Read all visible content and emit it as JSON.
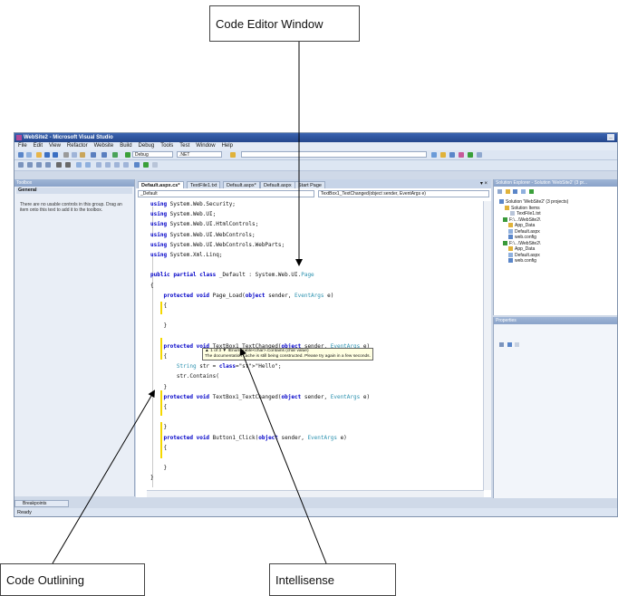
{
  "callouts": {
    "code_editor": "Code Editor Window",
    "code_outlining": "Code Outlining",
    "intellisense": "Intellisense"
  },
  "window": {
    "title": "WebSite2 - Microsoft Visual Studio",
    "minimize_label": "_"
  },
  "menu": [
    "File",
    "Edit",
    "View",
    "Refactor",
    "Website",
    "Build",
    "Debug",
    "Tools",
    "Test",
    "Window",
    "Help"
  ],
  "toolbar": {
    "config_value": "Debug",
    "platform_value": ".NET"
  },
  "toolbox": {
    "title": "Toolbox",
    "group": "General",
    "message": "There are no usable controls in this group. Drag an item onto this text to add it to the toolbox."
  },
  "editor": {
    "tabs": [
      "Default.aspx.cs*",
      "TextFile1.txt",
      "Default.aspx*",
      "Default.aspx",
      "Start Page"
    ],
    "class_combo": "_Default",
    "member_combo": "TextBox1_TextChanged(object sender, EventArgs e)",
    "code_lines": [
      "using System.Web.Security;",
      "using System.Web.UI;",
      "using System.Web.UI.HtmlControls;",
      "using System.Web.UI.WebControls;",
      "using System.Web.UI.WebControls.WebParts;",
      "using System.Xml.Linq;",
      "",
      "public partial class _Default : System.Web.UI.Page",
      "{",
      "    protected void Page_Load(object sender, EventArgs e)",
      "    {",
      "",
      "    }",
      "",
      "    protected void TextBox1_TextChanged(object sender, EventArgs e)",
      "    {",
      "        String str = \"Hello\";",
      "        str.Contains(",
      "    }",
      "    protected void TextBox1_TextChanged(object sender, EventArgs e)",
      "    {",
      "",
      "    }",
      "    protected void Button1_Click(object sender, EventArgs e)",
      "    {",
      "",
      "    }",
      "}"
    ],
    "intellisense_line1": "▲ 1 of 3 ▼ IEnumerable<char>.Contains (char value)",
    "intellisense_line2": "The documentation cache is still being constructed. Please try again in a few seconds."
  },
  "solution_explorer": {
    "title": "Solution Explorer - Solution 'WebSite2' (3 pr...",
    "items": [
      "Solution 'WebSite2' (3 projects)",
      "Solution Items",
      "TextFile1.txt",
      "F:\\...\\WebSite2\\",
      "App_Data",
      "Default.aspx",
      "web.config",
      "F:\\...\\WebSite2\\",
      "App_Data",
      "Default.aspx",
      "web.config"
    ]
  },
  "properties": {
    "title": "Properties"
  },
  "bottom_tab": "Breakpoints",
  "status": "Ready"
}
